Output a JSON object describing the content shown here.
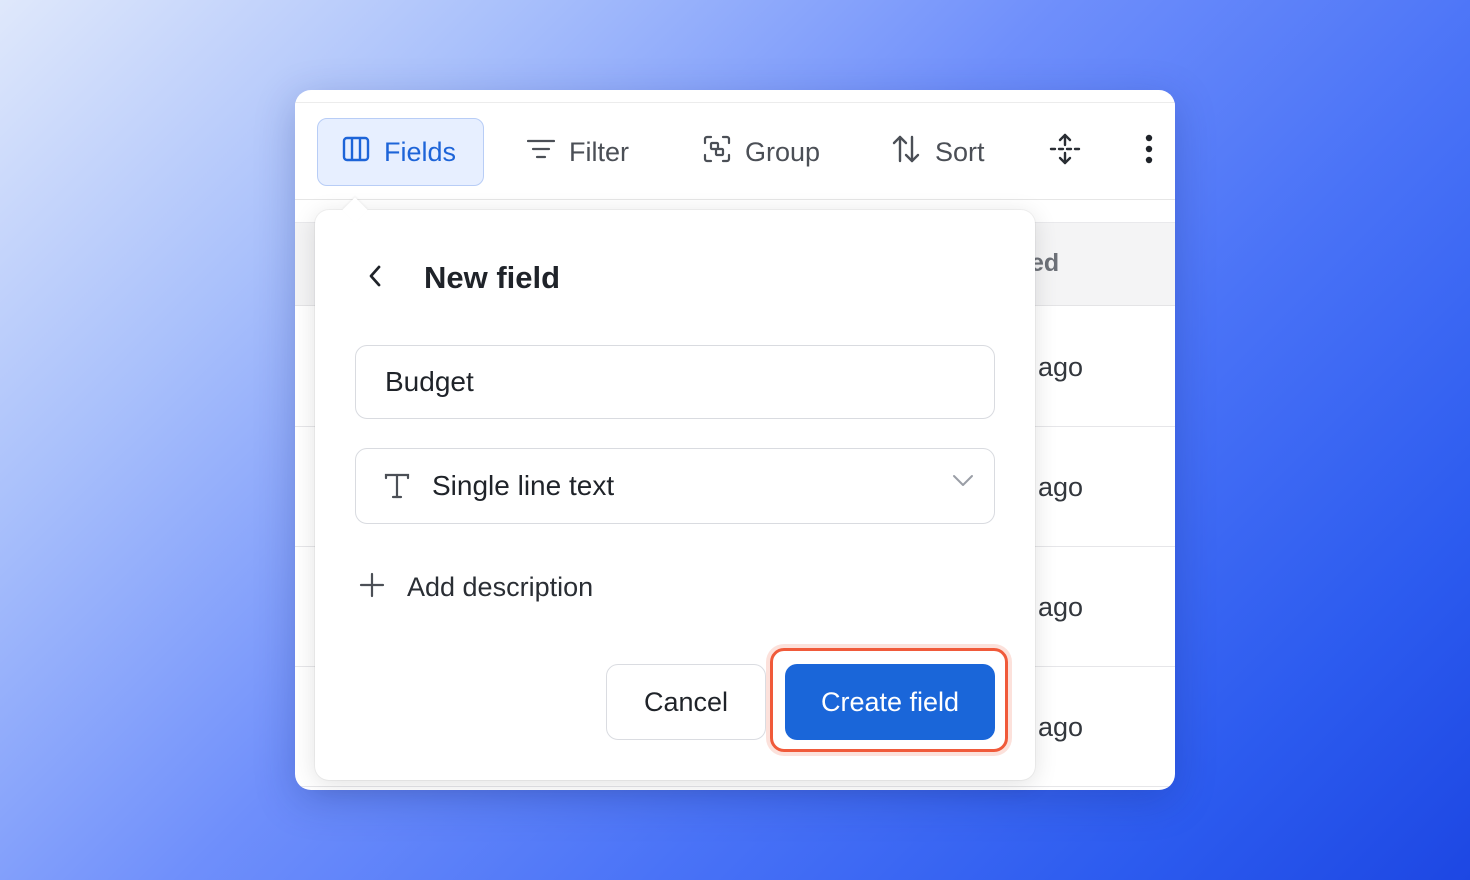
{
  "toolbar": {
    "fields_label": "Fields",
    "filter_label": "Filter",
    "group_label": "Group",
    "sort_label": "Sort",
    "icons": {
      "fields": "columns-icon",
      "filter": "filter-icon",
      "group": "group-icon",
      "sort": "sort-icon",
      "row_height": "row-height-icon",
      "more": "more-vertical-icon"
    }
  },
  "table": {
    "header_partial": "ed",
    "rows": [
      "ago",
      "ago",
      "ago",
      "ago"
    ]
  },
  "new_field": {
    "title": "New field",
    "name_value": "Budget",
    "type_label": "Single line text",
    "add_description_label": "Add description",
    "cancel_label": "Cancel",
    "create_label": "Create field"
  },
  "colors": {
    "accent": "#1a66d9",
    "fields_active_bg": "#e7efff",
    "highlight": "#f05a3a"
  }
}
